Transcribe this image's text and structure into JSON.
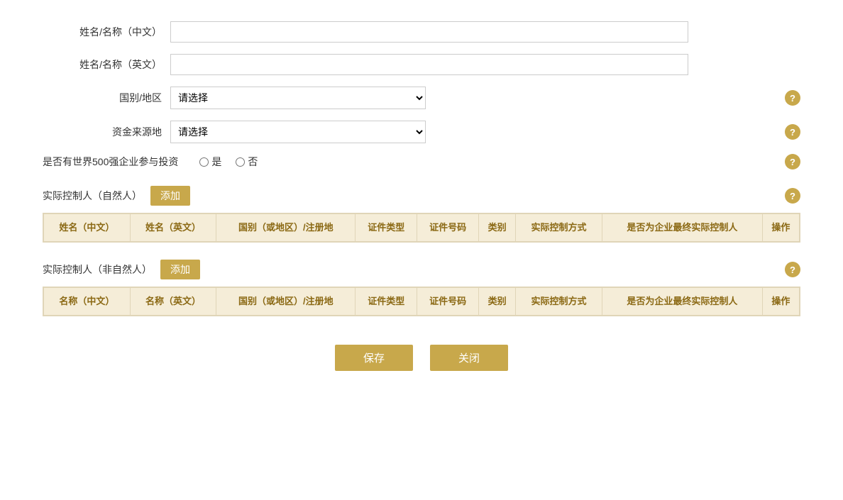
{
  "form": {
    "name_cn_label": "姓名/名称（中文）",
    "name_en_label": "姓名/名称（英文）",
    "country_label": "国别/地区",
    "country_placeholder": "请选择",
    "fund_source_label": "资金来源地",
    "fund_source_placeholder": "请选择",
    "world500_label": "是否有世界500强企业参与投资",
    "radio_yes": "是",
    "radio_no": "否"
  },
  "section1": {
    "title": "实际控制人（自然人）",
    "add_label": "添加",
    "help_icon": "?",
    "columns": [
      "姓名（中文）",
      "姓名（英文）",
      "国别（或地区）/注册地",
      "证件类型",
      "证件号码",
      "类别",
      "实际控制方式",
      "是否为企业最终实际控制人",
      "操作"
    ]
  },
  "section2": {
    "title": "实际控制人（非自然人）",
    "add_label": "添加",
    "help_icon": "?",
    "columns": [
      "名称（中文）",
      "名称（英文）",
      "国别（或地区）/注册地",
      "证件类型",
      "证件号码",
      "类别",
      "实际控制方式",
      "是否为企业最终实际控制人",
      "操作"
    ]
  },
  "buttons": {
    "save": "保存",
    "close": "关闭"
  },
  "help": "?"
}
